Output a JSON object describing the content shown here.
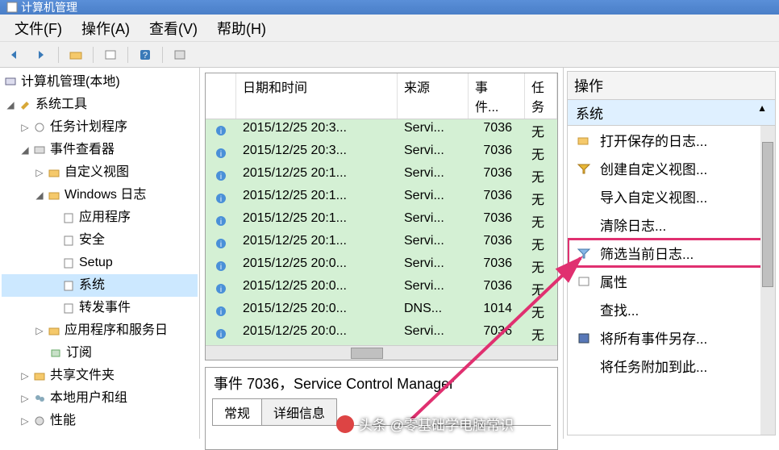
{
  "titlebar": {
    "title": "计算机管理"
  },
  "menubar": {
    "items": [
      "文件(F)",
      "操作(A)",
      "查看(V)",
      "帮助(H)"
    ]
  },
  "tree": {
    "root": "计算机管理(本地)",
    "system_tools": "系统工具",
    "task_scheduler": "任务计划程序",
    "event_viewer": "事件查看器",
    "custom_views": "自定义视图",
    "windows_logs": "Windows 日志",
    "app_log": "应用程序",
    "security_log": "安全",
    "setup_log": "Setup",
    "system_log": "系统",
    "forwarded": "转发事件",
    "app_services": "应用程序和服务日",
    "subscriptions": "订阅",
    "shared_folders": "共享文件夹",
    "local_users": "本地用户和组",
    "performance": "性能"
  },
  "grid": {
    "headers": {
      "date": "日期和时间",
      "source": "来源",
      "event": "事件...",
      "task": "任务"
    },
    "rows": [
      {
        "date": "2015/12/25 20:3...",
        "source": "Servi...",
        "event": "7036",
        "task": "无"
      },
      {
        "date": "2015/12/25 20:3...",
        "source": "Servi...",
        "event": "7036",
        "task": "无"
      },
      {
        "date": "2015/12/25 20:1...",
        "source": "Servi...",
        "event": "7036",
        "task": "无"
      },
      {
        "date": "2015/12/25 20:1...",
        "source": "Servi...",
        "event": "7036",
        "task": "无"
      },
      {
        "date": "2015/12/25 20:1...",
        "source": "Servi...",
        "event": "7036",
        "task": "无"
      },
      {
        "date": "2015/12/25 20:1...",
        "source": "Servi...",
        "event": "7036",
        "task": "无"
      },
      {
        "date": "2015/12/25 20:0...",
        "source": "Servi...",
        "event": "7036",
        "task": "无"
      },
      {
        "date": "2015/12/25 20:0...",
        "source": "Servi...",
        "event": "7036",
        "task": "无"
      },
      {
        "date": "2015/12/25 20:0...",
        "source": "DNS...",
        "event": "1014",
        "task": "无"
      },
      {
        "date": "2015/12/25 20:0...",
        "source": "Servi...",
        "event": "7036",
        "task": "无"
      }
    ]
  },
  "detail": {
    "title": "事件 7036，Service Control Manager",
    "tab_general": "常规",
    "tab_details": "详细信息"
  },
  "actions": {
    "header": "操作",
    "section": "系统",
    "items": [
      "打开保存的日志...",
      "创建自定义视图...",
      "导入自定义视图...",
      "清除日志...",
      "筛选当前日志...",
      "属性",
      "查找...",
      "将所有事件另存...",
      "将任务附加到此..."
    ]
  },
  "watermark": {
    "text": "头条 @零基础学电脑常识"
  }
}
